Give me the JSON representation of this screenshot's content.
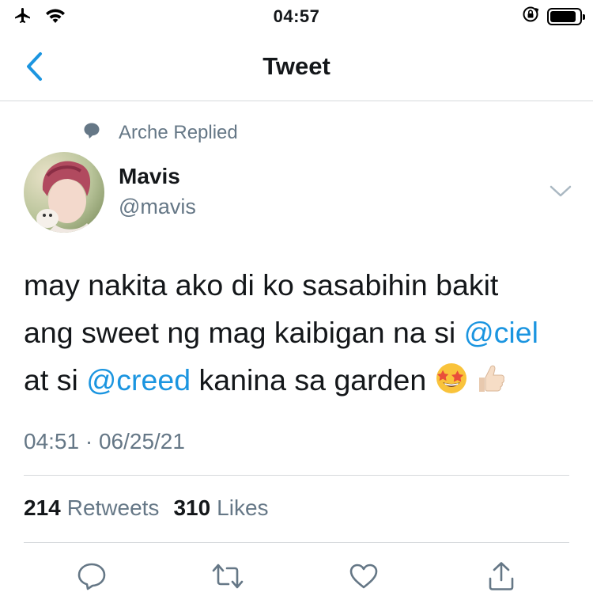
{
  "status_bar": {
    "time": "04:57",
    "battery_level": 0.9
  },
  "nav": {
    "title": "Tweet"
  },
  "tweet": {
    "context_label": "Arche Replied",
    "author": {
      "name": "Mavis",
      "handle": "@mavis"
    },
    "body": {
      "line1": "may nakita ako di ko sasabihin bakit",
      "line2_text": "ang sweet ng mag kaibigan na si ",
      "mention1": "@ciel",
      "line3_pre": "at si ",
      "mention2": "@creed",
      "line3_post": " kanina sa garden "
    },
    "timestamp": "04:51 · 06/25/21",
    "stats": {
      "retweets_count": "214",
      "retweets_label": "Retweets",
      "likes_count": "310",
      "likes_label": "Likes"
    }
  },
  "colors": {
    "accent": "#1b95e0",
    "secondary_text": "#657786",
    "primary_text": "#14171a",
    "divider": "#d6d9dc"
  },
  "icons": {
    "status": [
      "airplane-icon",
      "wifi-icon",
      "rotation-lock-icon",
      "battery-icon"
    ],
    "actions": [
      "reply-icon",
      "retweet-icon",
      "like-icon",
      "share-icon"
    ],
    "emoji": [
      "star-struck-emoji",
      "thumbs-up-emoji"
    ]
  }
}
